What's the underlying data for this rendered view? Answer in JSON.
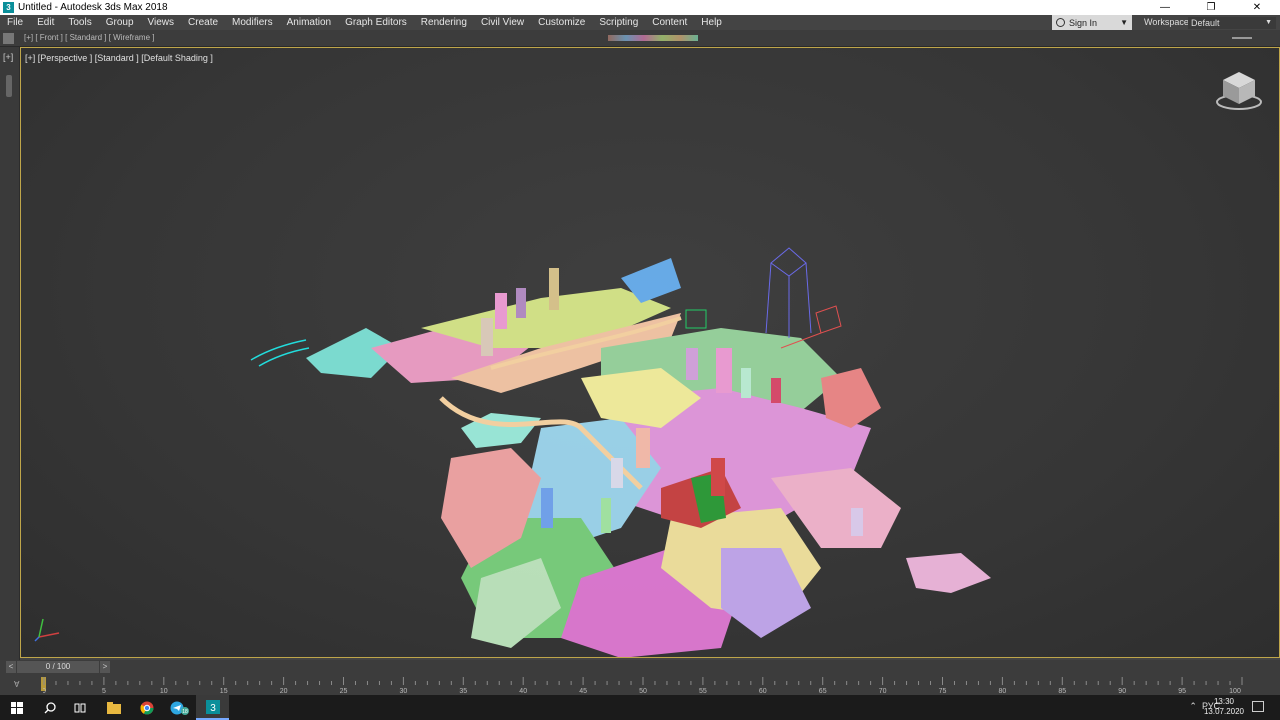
{
  "window": {
    "title": "Untitled - Autodesk 3ds Max 2018",
    "app_icon_label": "3"
  },
  "menubar": {
    "items": [
      "File",
      "Edit",
      "Tools",
      "Group",
      "Views",
      "Create",
      "Modifiers",
      "Animation",
      "Graph Editors",
      "Rendering",
      "Civil View",
      "Customize",
      "Scripting",
      "Content",
      "Help"
    ]
  },
  "account": {
    "sign_in_label": "Sign In",
    "workspaces_label": "Workspaces:",
    "workspace_value": "Default"
  },
  "top_viewport": {
    "label": "[+] [ Front ] [ Standard ] [ Wireframe ]"
  },
  "left_strip": {
    "plus_label": "[+]"
  },
  "viewport": {
    "label": "[+] [Perspective ] [Standard ] [Default Shading ]",
    "border_color": "#bfa64a"
  },
  "timeline": {
    "frame_display": "0 / 100",
    "prev_label": "<",
    "next_label": ">",
    "ruler_ticks": [
      "0",
      "5",
      "10",
      "15",
      "20",
      "25",
      "30",
      "35",
      "40",
      "45",
      "50",
      "55",
      "60",
      "65",
      "70",
      "75",
      "80",
      "85",
      "90",
      "95",
      "100"
    ]
  },
  "taskbar": {
    "language": "РУС",
    "time": "13:30",
    "date": "13.07.2020",
    "telegram_badge": "18",
    "max_icon_label": "3"
  },
  "icons": {
    "app": "3dsmax-icon",
    "minimize": "minimize-icon",
    "maximize": "restore-icon",
    "close": "close-icon",
    "user": "user-icon",
    "viewcube": "viewcube-icon",
    "axis": "axis-tripod-icon",
    "start": "windows-start-icon",
    "search": "search-icon",
    "taskview": "task-view-icon",
    "explorer": "folder-icon",
    "chrome": "chrome-icon",
    "telegram": "telegram-icon",
    "max": "3dsmax-taskbar-icon"
  }
}
